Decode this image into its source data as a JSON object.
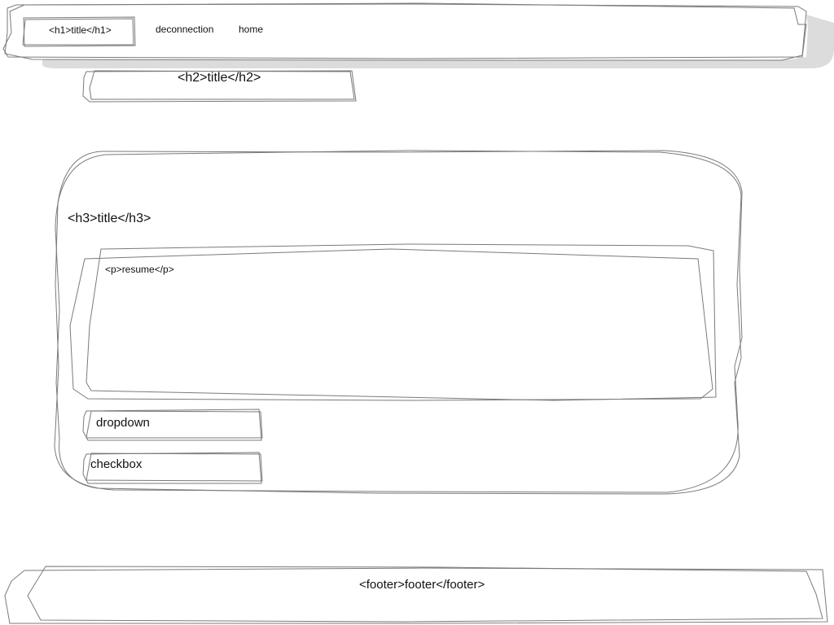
{
  "header": {
    "title": "<h1>title</h1>",
    "nav": [
      {
        "label": "deconnection"
      },
      {
        "label": "home"
      }
    ]
  },
  "page": {
    "subtitle": "<h2>title</h2>"
  },
  "card": {
    "heading": "<h3>title</h3>",
    "resume": "<p>resume</p>",
    "dropdown_label": "dropdown",
    "checkbox_label": "checkbox"
  },
  "footer": {
    "text": "<footer>footer</footer>"
  },
  "colors": {
    "stroke": "#7a7a7a",
    "shadow": "#dcdcdc",
    "text": "#111111"
  }
}
